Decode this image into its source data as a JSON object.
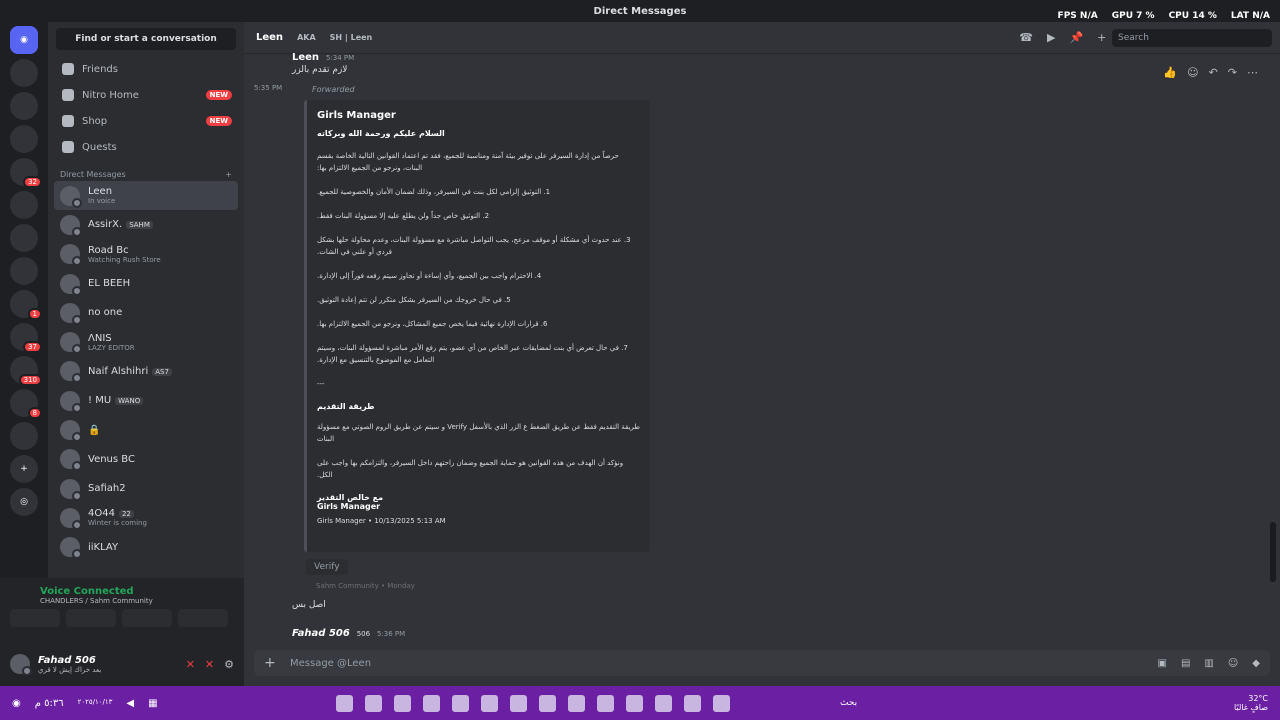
{
  "window": {
    "title": "Direct Messages"
  },
  "stats": [
    {
      "label": "FPS",
      "value": "N/A"
    },
    {
      "label": "GPU",
      "value": "7 %"
    },
    {
      "label": "CPU",
      "value": "14 %"
    },
    {
      "label": "LAT",
      "value": "N/A"
    }
  ],
  "servers": [
    {
      "name": "home",
      "badge": ""
    },
    {
      "name": "srv1",
      "badge": ""
    },
    {
      "name": "srv2",
      "badge": ""
    },
    {
      "name": "srv3",
      "badge": ""
    },
    {
      "name": "srv4",
      "badge": "32"
    },
    {
      "name": "srv5",
      "badge": ""
    },
    {
      "name": "srv6",
      "badge": ""
    },
    {
      "name": "srv7",
      "badge": ""
    },
    {
      "name": "srv8",
      "badge": "1"
    },
    {
      "name": "srv9",
      "badge": "37"
    },
    {
      "name": "srv10",
      "badge": "310"
    },
    {
      "name": "srv11",
      "badge": "8"
    },
    {
      "name": "srv12",
      "badge": ""
    }
  ],
  "sidebar": {
    "find": "Find or start a conversation",
    "nav": [
      {
        "label": "Friends",
        "new": ""
      },
      {
        "label": "Nitro Home",
        "new": "NEW"
      },
      {
        "label": "Shop",
        "new": "NEW"
      },
      {
        "label": "Quests",
        "new": ""
      }
    ],
    "dm_header": "Direct Messages",
    "dms": [
      {
        "name": "Leen",
        "sub": "In voice",
        "tag": ""
      },
      {
        "name": "AssirX.",
        "sub": "",
        "tag": "SAHM"
      },
      {
        "name": "Road Bc",
        "sub": "Watching Rush Store",
        "tag": ""
      },
      {
        "name": "EL BEEH",
        "sub": "",
        "tag": ""
      },
      {
        "name": "no one",
        "sub": "",
        "tag": ""
      },
      {
        "name": "ΛNIS",
        "sub": "LAZY EDITOR",
        "tag": ""
      },
      {
        "name": "Naif Alshihri",
        "sub": "",
        "tag": "AS7"
      },
      {
        "name": "! MU",
        "sub": "",
        "tag": "WANO"
      },
      {
        "name": "",
        "sub": "",
        "tag": ""
      },
      {
        "name": "Venus BC",
        "sub": "",
        "tag": ""
      },
      {
        "name": "Safiah2",
        "sub": "",
        "tag": ""
      },
      {
        "name": "4O44",
        "sub": "Winter is coming",
        "tag": "22"
      },
      {
        "name": "iiKLAY",
        "sub": "",
        "tag": ""
      }
    ]
  },
  "voice": {
    "status": "Voice Connected",
    "channel": "CHANDLERS / Sahm Community"
  },
  "user": {
    "name": "Fahad 506",
    "status": "بعد خراك إيش لا قري"
  },
  "chat": {
    "user": "Leen",
    "aka": "AKA",
    "alias": "SH | Leen",
    "search": "Search",
    "first_msg": {
      "author": "Leen",
      "time": "5:34 PM",
      "text": "لازم تقدم بالزر"
    },
    "fwd_time": "5:35 PM",
    "forwarded": "Forwarded",
    "embed": {
      "title": "Girls Manager",
      "greeting": "السلام عليكم ورحمة الله وبركاته",
      "intro": "حرصاً من إدارة السيرفر على توفير بيئة آمنة ومناسبة للجميع، فقد تم اعتماد القوانين التالية الخاصة بقسم البنات، ونرجو من الجميع الالتزام بها:",
      "rules": [
        "1. التوثيق إلزامي لكل بنت في السيرفر، وذلك لضمان الأمان والخصوصية للجميع.",
        "2. التوثيق خاص جداً ولن يطلع عليه إلا مسؤولة البنات فقط.",
        "3. عند حدوث أي مشكلة أو موقف مزعج، يجب التواصل مباشرة مع مسؤولة البنات، وعدم محاولة حلها بشكل فردي أو علني في الشات.",
        "4. الاحترام واجب بين الجميع، وأي إساءة أو تجاوز سيتم رفعه فوراً إلى الإدارة.",
        "5. في حال خروجك من السيرفر بشكل متكرر لن تتم إعادة التوثيق.",
        "6. قرارات الإدارة نهائية فيما يخص جميع المشاكل، ونرجو من الجميع الالتزام بها.",
        "7. في حال تعرض أي بنت لمضايقات عبر الخاص من أي عضو، يتم رفع الأمر مباشرة لمسؤولة البنات، وسيتم التعامل مع الموضوع بالتنسيق مع الإدارة."
      ],
      "sep": "---",
      "method_title": "طريقة التقديم",
      "method": "طريقة التقديم فقط عن طريق الضغط ع الزر الذي بالأسفل Verify و سيتم عن طريق الروم الصوتي مع مسؤولة البنات",
      "closing": "ونؤكد أن الهدف من هذه القوانين هو حماية الجميع وضمان راحتهم داخل السيرفر، والتزامكم بها واجب على الكل.",
      "sign1": "مع خالص التقدير",
      "sign2": "Girls Manager",
      "footer": "Girls Manager • 10/13/2025 5:13 AM"
    },
    "verify": "Verify",
    "source": "Sahm Community • Monday",
    "msg2": "اصل بس",
    "last": {
      "author": "Fahad 506",
      "tag": "506",
      "time": "5:36 PM"
    },
    "composer": "Message @Leen"
  },
  "taskbar": {
    "search": "بحث",
    "temp": "32°C",
    "weather": "صافٍ غالبًا",
    "time": "٥:٣٦ م",
    "date": "٢٠٢٥/١٠/١٣"
  }
}
